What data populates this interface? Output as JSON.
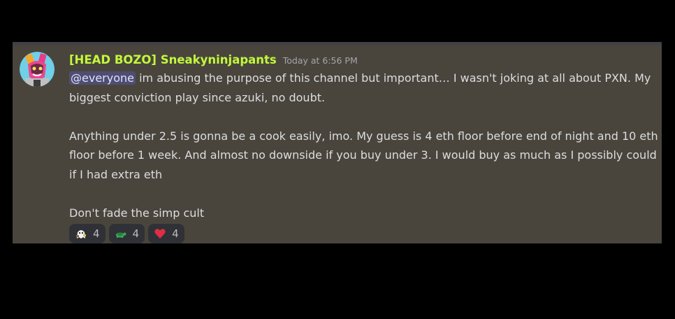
{
  "message": {
    "username": "[HEAD BOZO] Sneakyninjapants",
    "timestamp": "Today at 6:56 PM",
    "mention": "@everyone",
    "paragraph1_rest": " im abusing the purpose of this channel but important… I wasn't joking at all about PXN. My biggest conviction play since azuki, no doubt.",
    "paragraph2": "Anything under 2.5 is gonna be a cook easily, imo. My guess is 4 eth floor before end of night and 10 eth floor before 1 week. And almost no downside if you buy under 3. I would buy as much as I possibly could if I had extra eth",
    "paragraph3": "Don't fade the simp cult"
  },
  "reactions": [
    {
      "emoji": "ghost-character-emoji",
      "count": "4"
    },
    {
      "emoji": "turtle-emoji",
      "count": "4"
    },
    {
      "emoji": "red-heart-emoji",
      "count": "4"
    }
  ],
  "colors": {
    "username": "#c3f83a",
    "message_bg": "#49453d",
    "text": "#dcddde",
    "heart": "#dd2e44"
  }
}
